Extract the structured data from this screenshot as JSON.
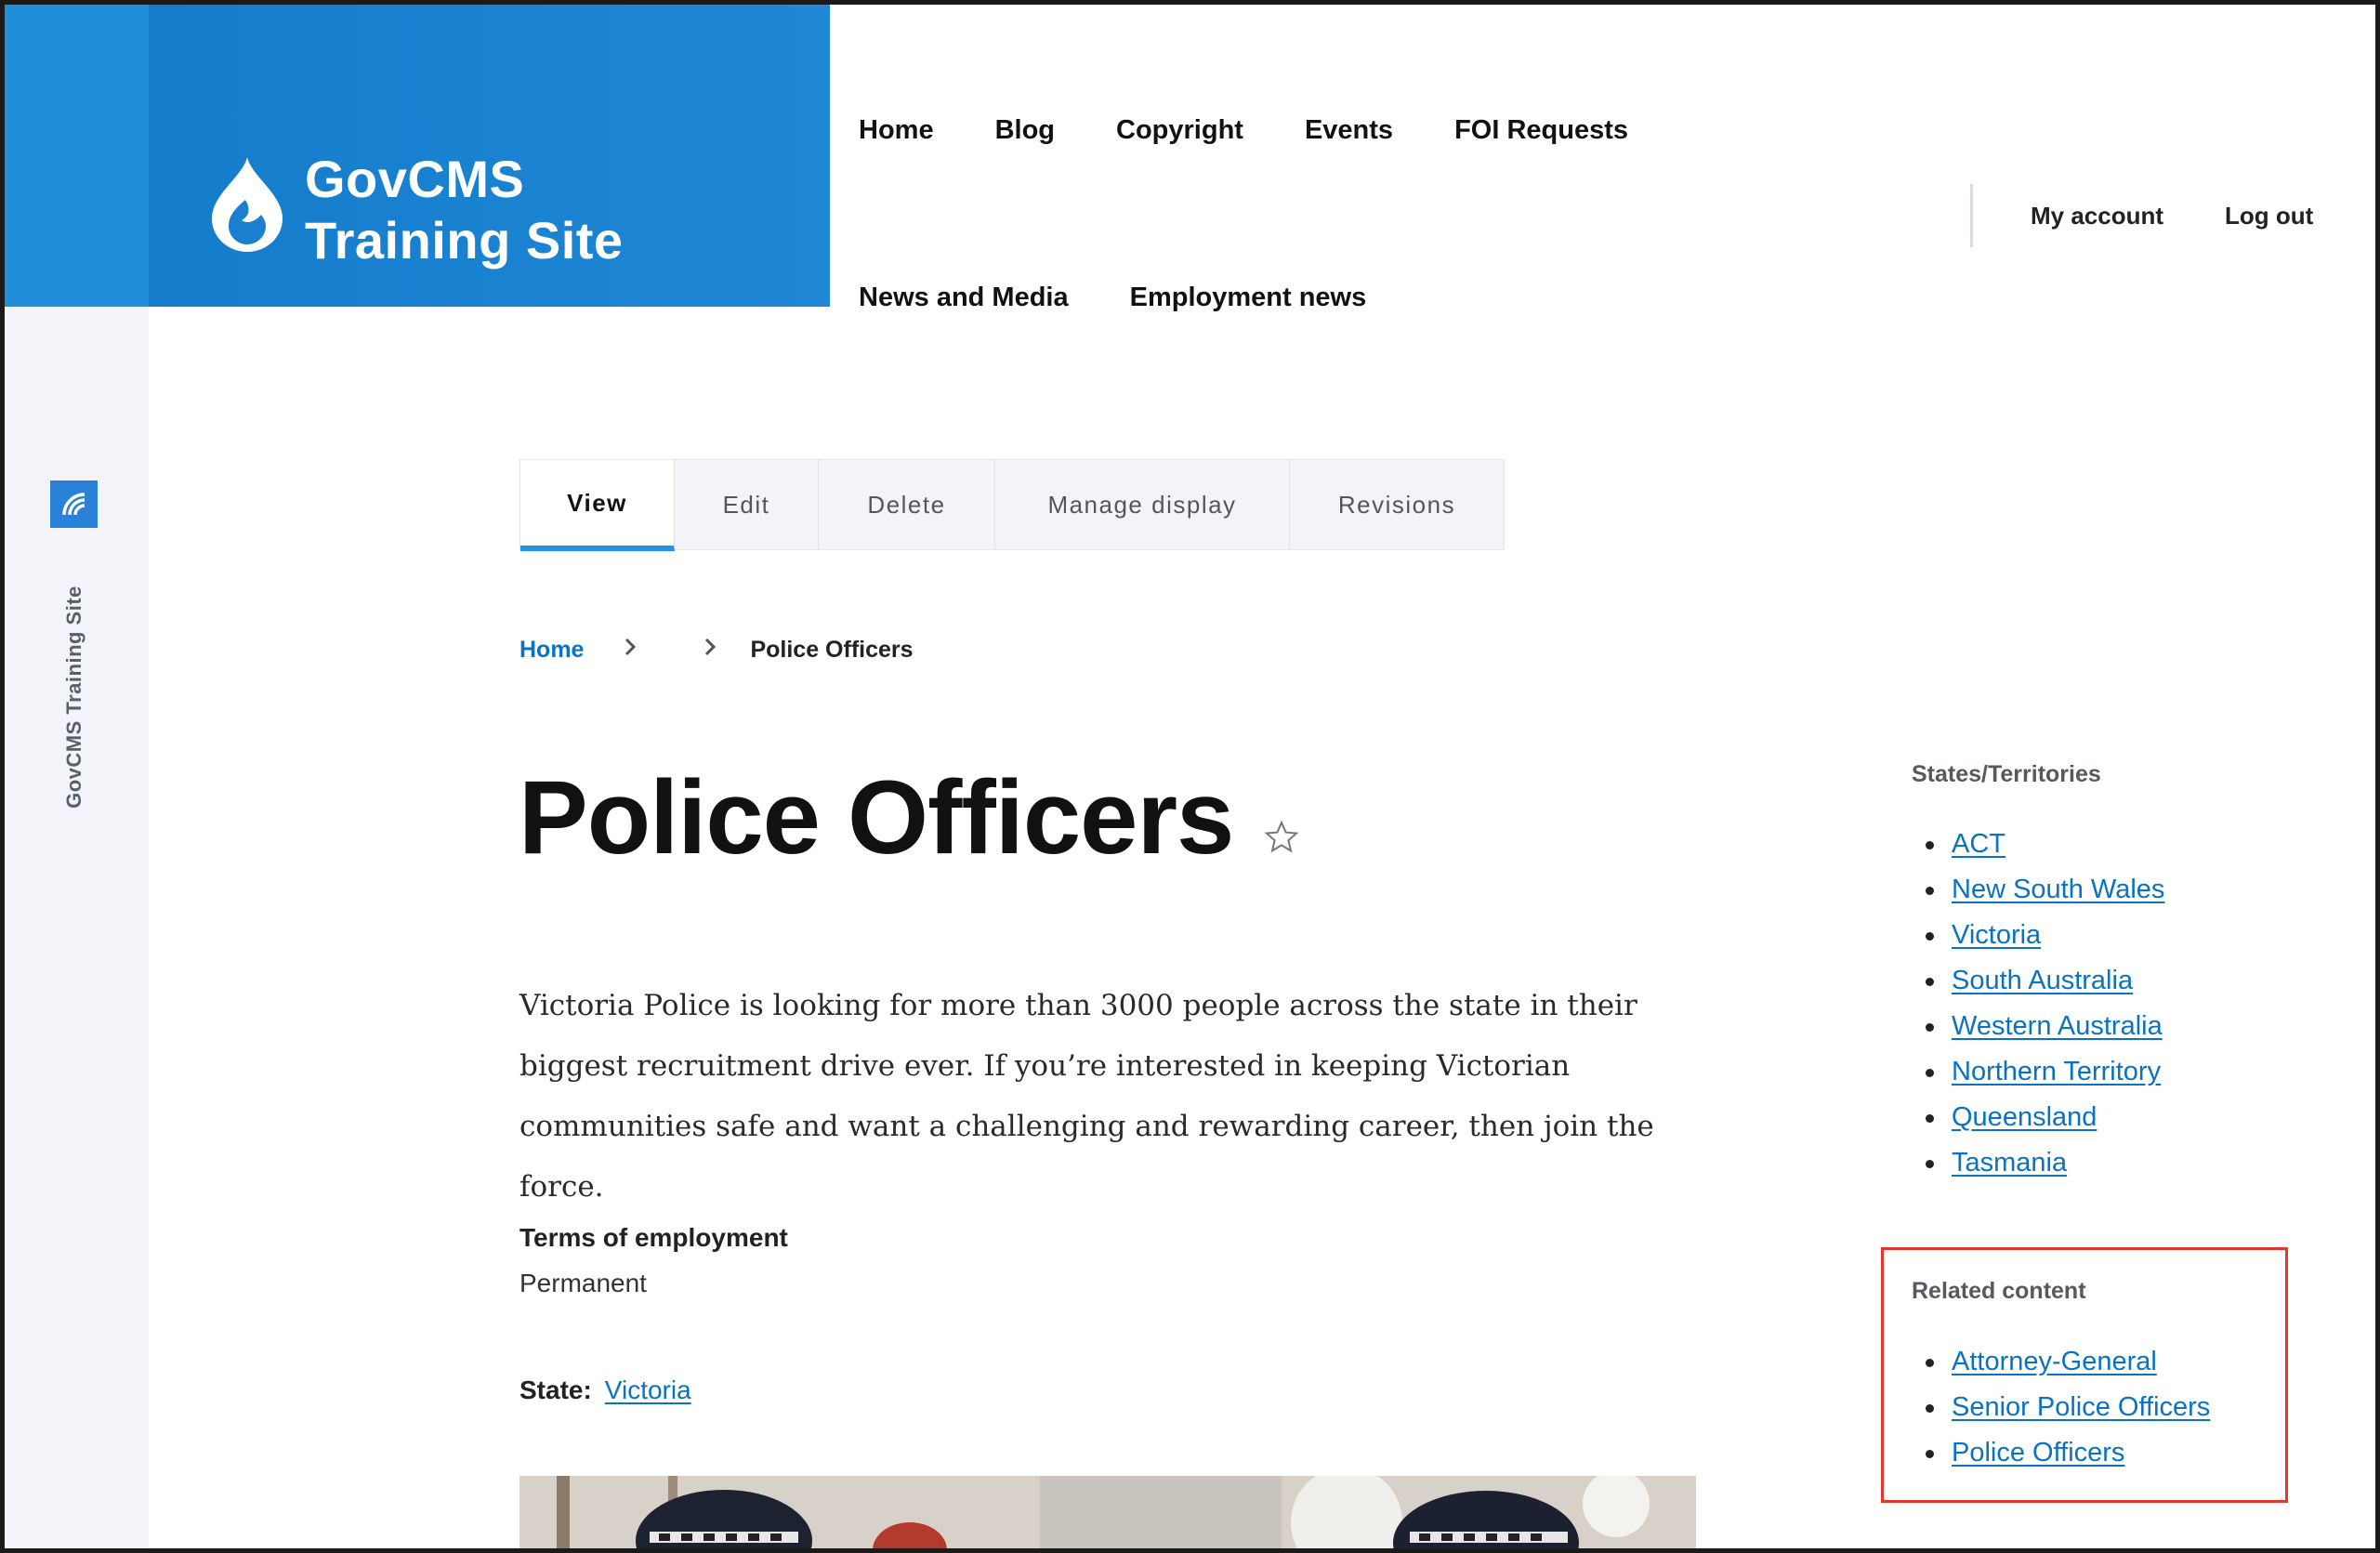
{
  "site": {
    "name_line1": "GovCMS",
    "name_line2": "Training Site",
    "toolbar_label": "GovCMS Training Site"
  },
  "nav_primary": {
    "row1": [
      "Home",
      "Blog",
      "Copyright",
      "Events",
      "FOI Requests"
    ],
    "row2": [
      "News and Media",
      "Employment news"
    ]
  },
  "nav_secondary": {
    "my_account": "My account",
    "log_out": "Log out"
  },
  "tabs": [
    {
      "label": "View",
      "active": true
    },
    {
      "label": "Edit",
      "active": false
    },
    {
      "label": "Delete",
      "active": false
    },
    {
      "label": "Manage display",
      "active": false
    },
    {
      "label": "Revisions",
      "active": false
    }
  ],
  "breadcrumb": {
    "home": "Home",
    "current": "Police Officers"
  },
  "page": {
    "title": "Police Officers",
    "body": "Victoria Police is looking for more than 3000 people across the state in their biggest recruitment drive ever. If you’re interested in keeping Victorian communities safe and want a challenging and rewarding career, then join the force.",
    "terms_label": "Terms of employment",
    "terms_value": "Permanent",
    "state_label": "State:",
    "state_value": "Victoria"
  },
  "sidebar": {
    "states_title": "States/Territories",
    "states": [
      "ACT",
      "New South Wales",
      "Victoria",
      "South Australia",
      "Western Australia",
      "Northern Territory",
      "Queensland",
      "Tasmania"
    ],
    "related_title": "Related content",
    "related": [
      "Attorney-General",
      "Senior Police Officers",
      "Police Officers"
    ]
  },
  "colors": {
    "brand_blue": "#1e88d6",
    "link_blue": "#0a72c2",
    "tab_active_underline": "#2493e0",
    "highlight_red": "#e2372a"
  },
  "icons": {
    "logo": "drupal-drop-icon",
    "toolbar": "toolbar-home-icon",
    "favorite": "star-outline-icon",
    "breadcrumb_separator": "chevron-right-icon"
  }
}
